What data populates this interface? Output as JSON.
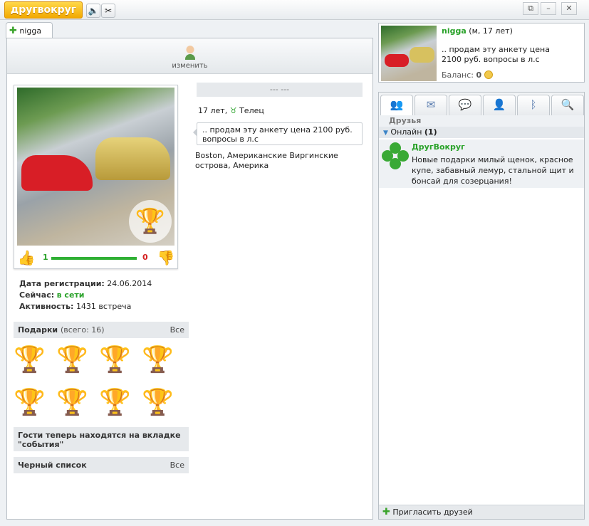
{
  "app": {
    "logo_text": "другвокруг"
  },
  "toolbar": {
    "sound_icon": "speaker-icon",
    "settings_icon": "tools-icon"
  },
  "window": {
    "restore": "⧉",
    "minimize": "–",
    "close": "✕"
  },
  "tab": {
    "label": "nigga"
  },
  "profile": {
    "edit_label": "изменить",
    "rating": {
      "likes": "1",
      "dislikes": "0"
    },
    "registration_label": "Дата регистрации:",
    "registration_date": "24.06.2014",
    "now_label": "Сейчас:",
    "now_value": "в сети",
    "activity_label": "Активность:",
    "activity_value": "1431 встреча",
    "name_placeholder": "--- ---",
    "age": "17 лет,",
    "zodiac": "Телец",
    "status": ".. продам эту анкету цена 2100 руб. вопросы в л.с",
    "location": "Boston, Американские Виргинские острова, Америка"
  },
  "gifts": {
    "title": "Подарки",
    "count": "(всего: 16)",
    "all_link": "Все",
    "items": [
      "trophy",
      "trophy",
      "trophy",
      "trophy",
      "trophy",
      "trophy",
      "trophy",
      "trophy"
    ]
  },
  "guests_notice": "Гости теперь находятся на вкладке \"события\"",
  "blacklist": {
    "title": "Черный список",
    "all_link": "Все"
  },
  "user": {
    "name": "nigga",
    "meta": "(м, 17 лет)",
    "status": ".. продам эту анкету цена 2100 руб. вопросы в л.с",
    "balance_label": "Баланс:",
    "balance_value": "0"
  },
  "right_tabs": [
    "friends-icon",
    "mail-icon",
    "chat-icon",
    "people-icon",
    "bluetooth-icon",
    "search-icon"
  ],
  "friends": {
    "title": "Друзья",
    "online_label": "Онлайн",
    "online_count": "(1)",
    "items": [
      {
        "name": "ДругВокруг",
        "text": "Новые подарки милый щенок, красное купе, забавный лемур, стальной щит и бонсай для созерцания!"
      }
    ]
  },
  "invite_label": "Пригласить друзей"
}
